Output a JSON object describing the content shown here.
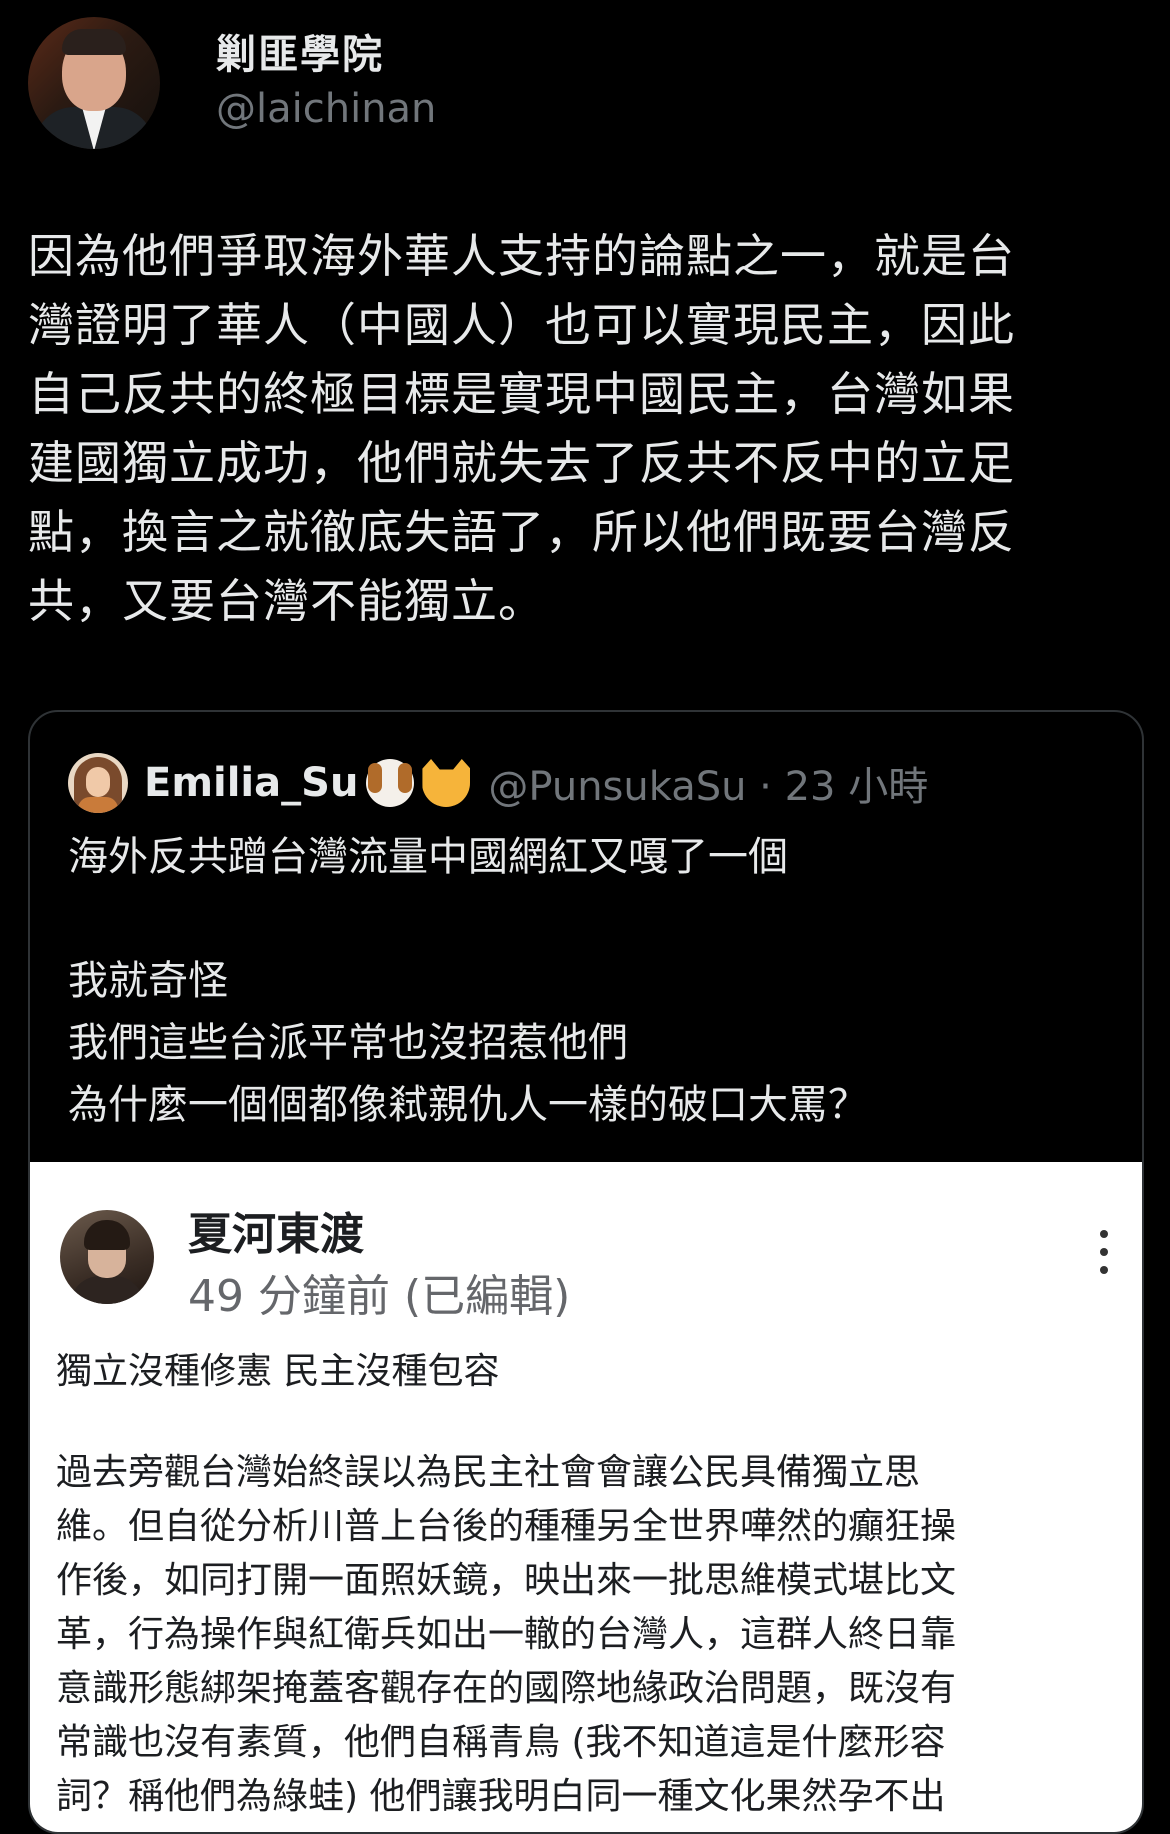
{
  "tweet": {
    "author": {
      "display_name": "剿匪學院",
      "handle": "@laichinan"
    },
    "text": "因為他們爭取海外華人支持的論點之一，就是台\n灣證明了華人（中國人）也可以實現民主，因此\n自己反共的終極目標是實現中國民主，台灣如果\n建國獨立成功，他們就失去了反共不反中的立足\n點，換言之就徹底失語了，所以他們既要台灣反\n共，又要台灣不能獨立。"
  },
  "quoted_tweet": {
    "display_name": "Emilia_Su",
    "name_emojis": [
      "dog-face-emoji",
      "cat-face-emoji"
    ],
    "handle_time": "@PunsukaSu · 23 小時",
    "text": "海外反共蹭台灣流量中國網紅又嘎了一個\n\n我就奇怪\n我們這些台派平常也沒招惹他們\n為什麼一個個都像弒親仇人一樣的破口大罵？",
    "embedded_post": {
      "name": "夏河東渡",
      "time": "49 分鐘前 (已編輯)",
      "title": "獨立沒種修憲 民主沒種包容",
      "body": "過去旁觀台灣始終誤以為民主社會會讓公民具備獨立思\n維。但自從分析川普上台後的種種另全世界嘩然的癲狂操\n作後，如同打開一面照妖鏡，映出來一批思維模式堪比文\n革，行為操作與紅衛兵如出一轍的台灣人，這群人終日靠\n意識形態綁架掩蓋客觀存在的國際地緣政治問題，既沒有\n常識也沒有素質，他們自稱青鳥 (我不知道這是什麼形容\n詞？稱他們為綠蛙) 他們讓我明白同一種文化果然孕不出"
    }
  }
}
